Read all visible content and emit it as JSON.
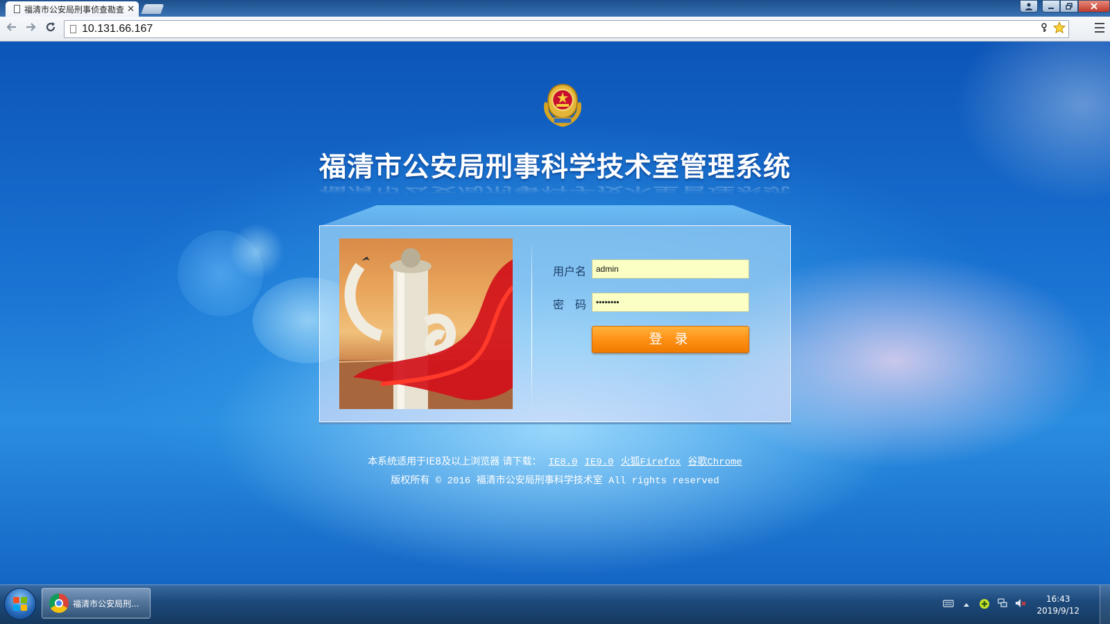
{
  "browser": {
    "tab_title": "福清市公安局刑事侦查勘查",
    "tab_close": "✕",
    "url": "10.131.66.167"
  },
  "page": {
    "system_title": "福清市公安局刑事科学技术室管理系统",
    "login": {
      "username_label": "用户名",
      "password_label": "密　码",
      "username_value": "admin",
      "password_value": "password",
      "login_button": "登 录"
    },
    "footer": {
      "browser_note": "本系统适用于IE8及以上浏览器 请下载：",
      "links": [
        "IE8.0",
        "IE9.0",
        "火狐Firefox",
        "谷歌Chrome"
      ],
      "copyright": "版权所有 © 2016  福清市公安局刑事科学技术室 All rights reserved"
    }
  },
  "taskbar": {
    "task_label": "福清市公安局刑...",
    "time": "16:43",
    "date": "2019/9/12"
  },
  "icons": {
    "back": "arrow-left-icon",
    "forward": "arrow-right-icon",
    "reload": "reload-icon",
    "bookmark": "star-icon",
    "menu": "hamburger-menu-icon",
    "emblem": "police-emblem-icon"
  },
  "colors": {
    "login_button": "#ff9117",
    "input_background": "#fbffc4",
    "page_background": "#1a73d2"
  }
}
